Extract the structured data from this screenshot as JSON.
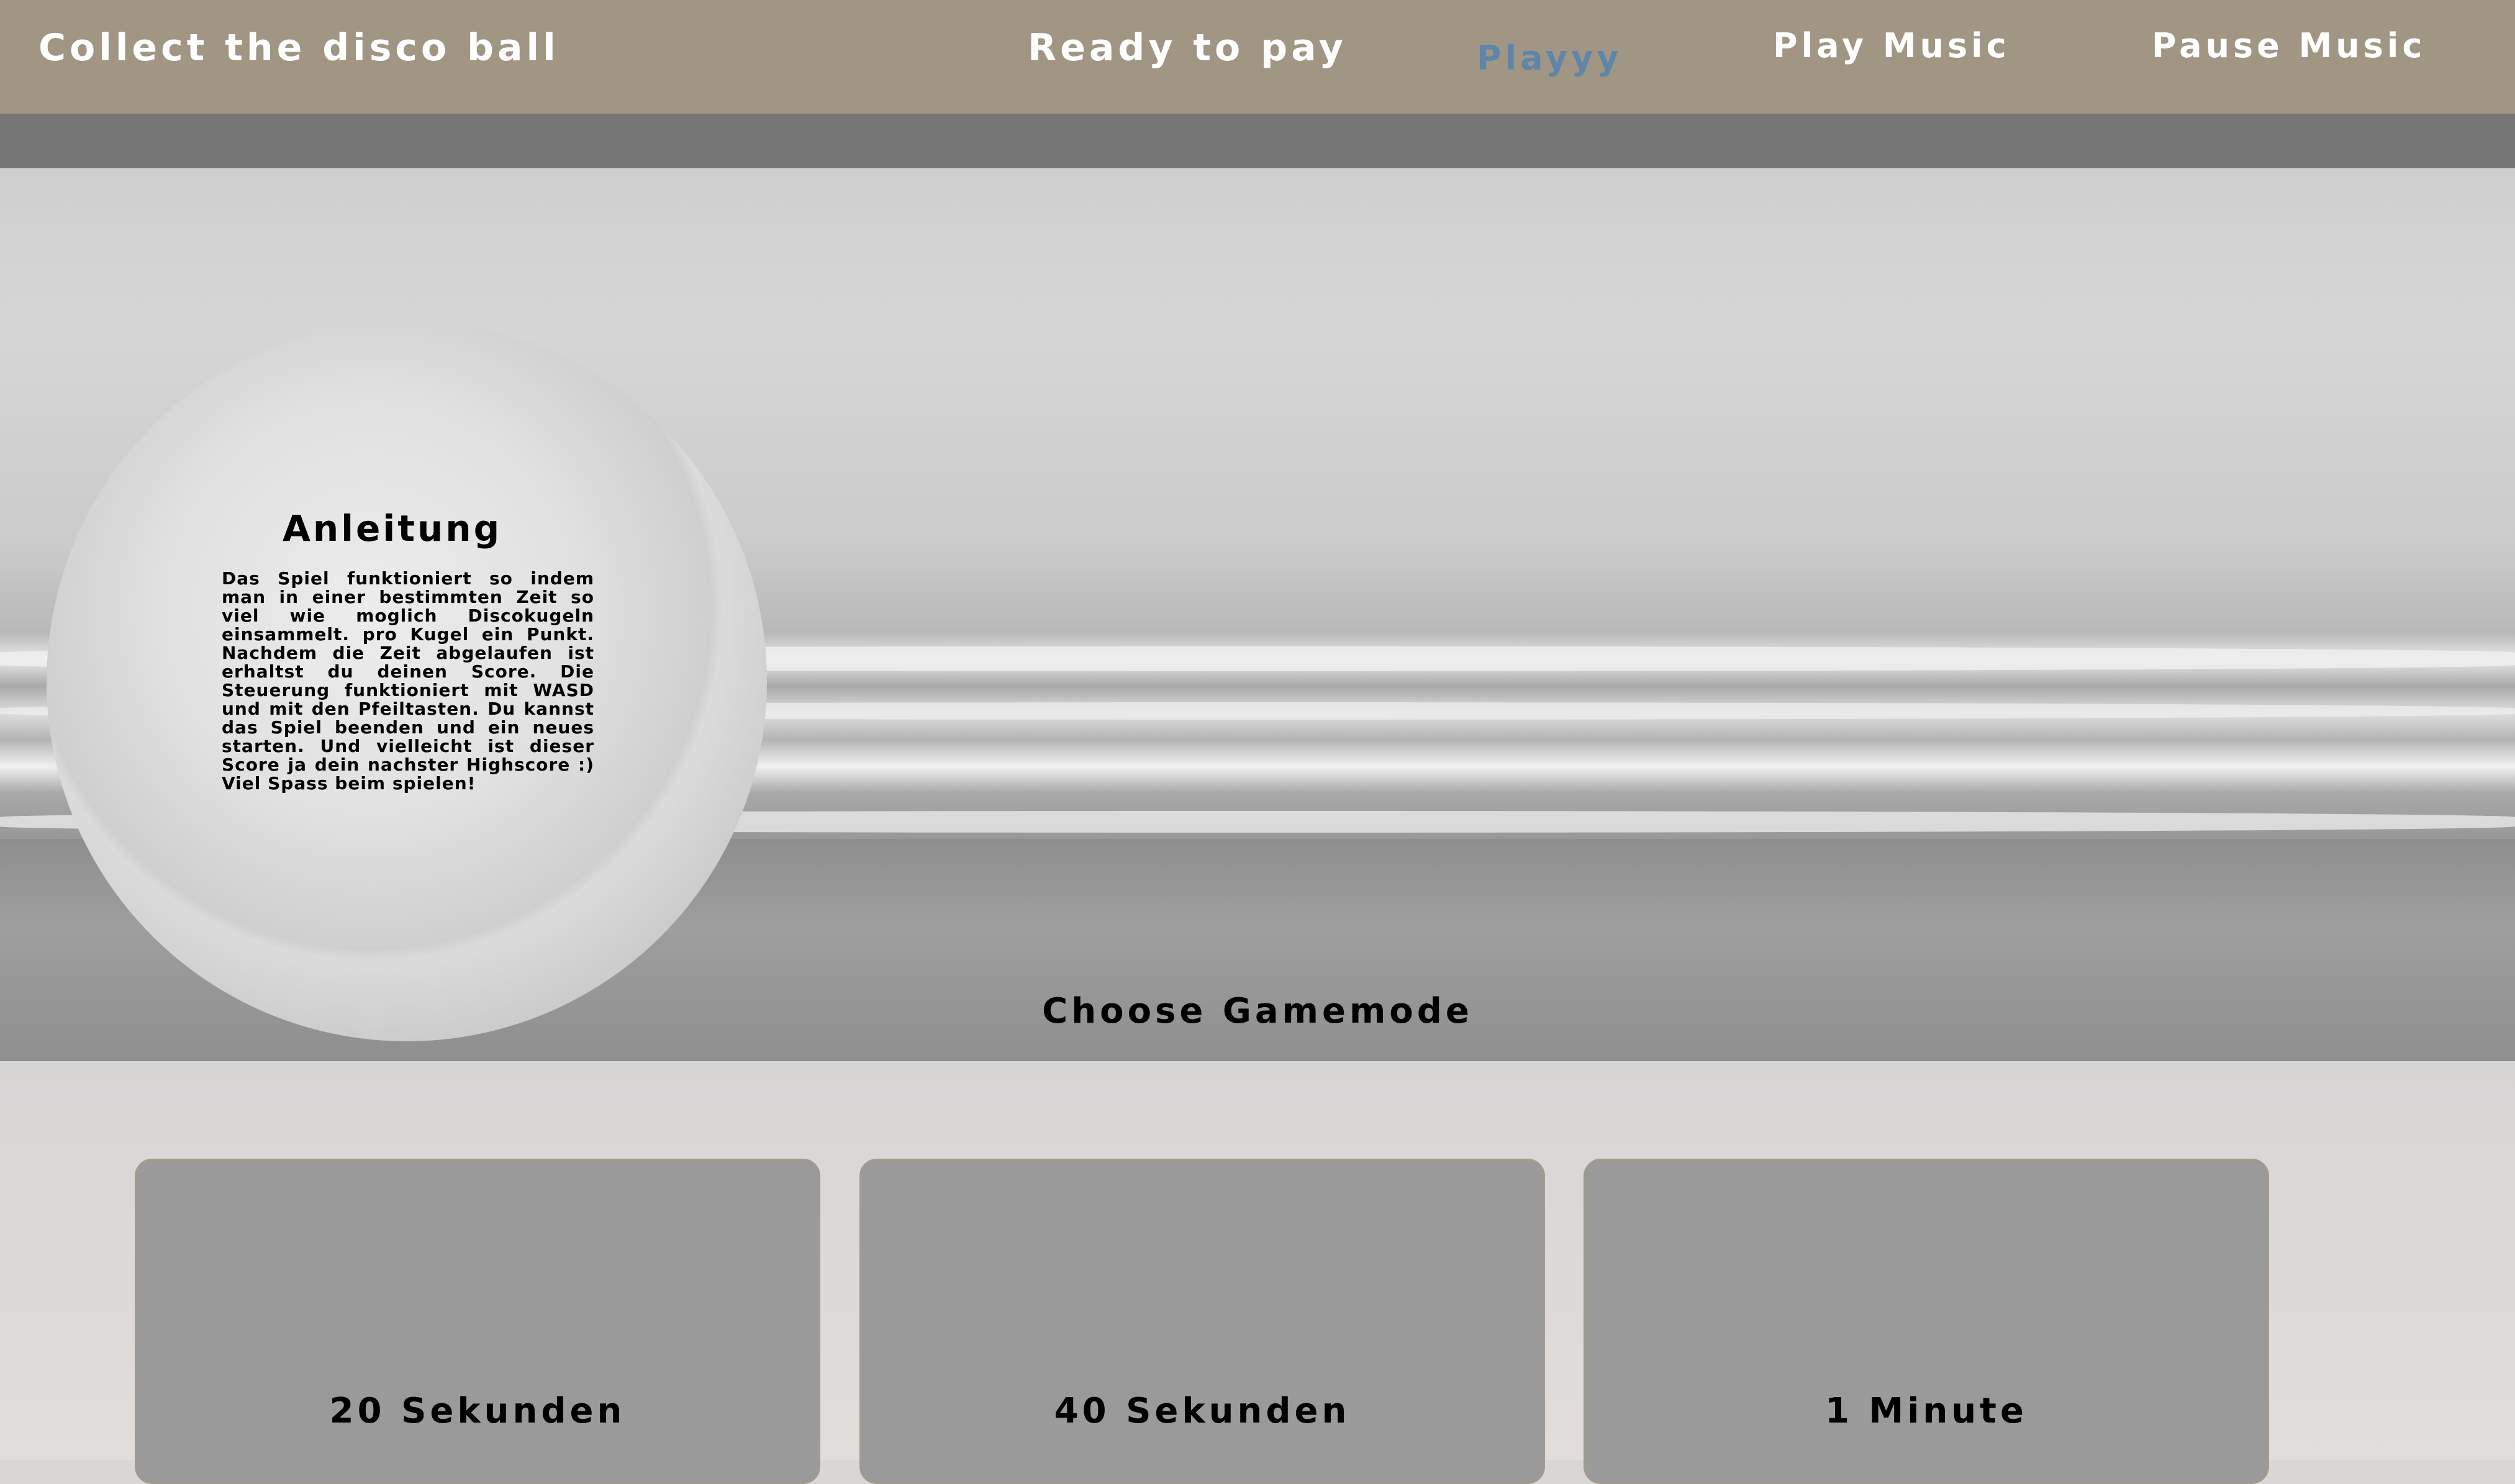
{
  "header": {
    "brand": "Collect the disco ball",
    "nav": {
      "ready": "Ready to pay",
      "play": "Playyy",
      "play_music": "Play Music",
      "pause_music": "Pause Music"
    }
  },
  "instructions": {
    "title": "Anleitung",
    "text": "Das Spiel funktioniert so indem man in einer bestimmten Zeit so viel wie moglich Discokugeln einsammelt. pro Kugel ein Punkt. Nachdem die Zeit abgelaufen ist erhaltst du deinen Score. Die Steuerung funktioniert mit WASD und mit den Pfeiltasten. Du kannst das Spiel beenden und ein neues starten. Und vielleicht ist dieser Score ja dein nachster Highscore :) Viel Spass beim spielen!"
  },
  "gamemode": {
    "title": "Choose Gamemode",
    "options": [
      "20 Sekunden",
      "40 Sekunden",
      "1 Minute"
    ]
  },
  "colors": {
    "topbar": "#a19684",
    "active_nav": "#5d86a8",
    "card": "#9a9a9a"
  }
}
